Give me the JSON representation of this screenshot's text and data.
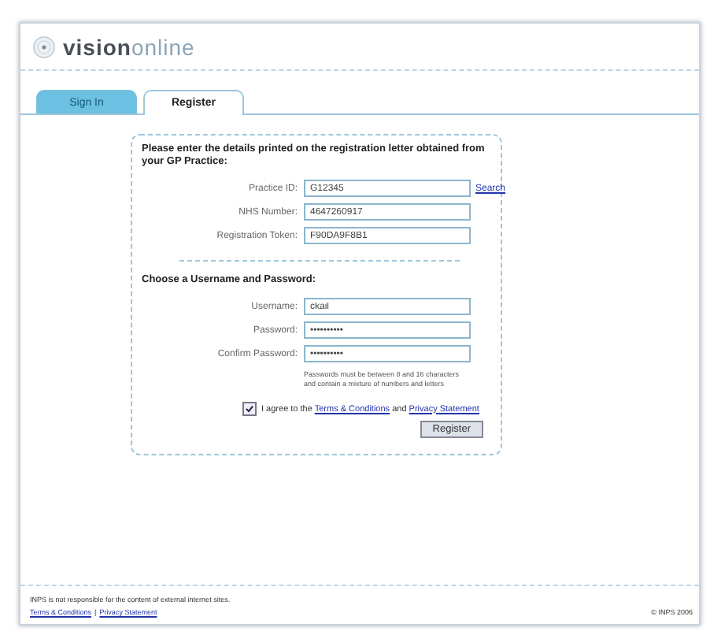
{
  "logo": {
    "strong": "vision",
    "light": "online"
  },
  "tabs": [
    {
      "label": "Sign In",
      "selected": false
    },
    {
      "label": "Register",
      "selected": true
    }
  ],
  "form": {
    "intro": "Please enter the details printed on the registration letter obtained from your GP Practice:",
    "details": [
      {
        "label": "Practice ID:",
        "value": "G12345",
        "link": "Search"
      },
      {
        "label": "NHS Number:",
        "value": "4647260917"
      },
      {
        "label": "Registration Token:",
        "value": "F90DA9F8B1"
      }
    ],
    "section_title": "Choose a Username and Password:",
    "account": [
      {
        "label": "Username:",
        "value": "ckail"
      },
      {
        "label": "Password:",
        "value": "••••••••••"
      },
      {
        "label": "Confirm Password:",
        "value": "••••••••••"
      }
    ],
    "hint": "Passwords must be between 8 and 16 characters and contain a mixture of numbers and letters",
    "agree": {
      "checked": true,
      "before": "I agree to the",
      "link_1": "Terms & Conditions",
      "middle": "and",
      "link_2": "Privacy Statement"
    },
    "submit": "Register"
  },
  "footer": {
    "disclaimer": "INPS is not responsible for the content of external internet sites.",
    "links": [
      "Terms & Conditions",
      "Privacy Statement"
    ],
    "separator": "|",
    "copyright": "© INPS 2006"
  }
}
